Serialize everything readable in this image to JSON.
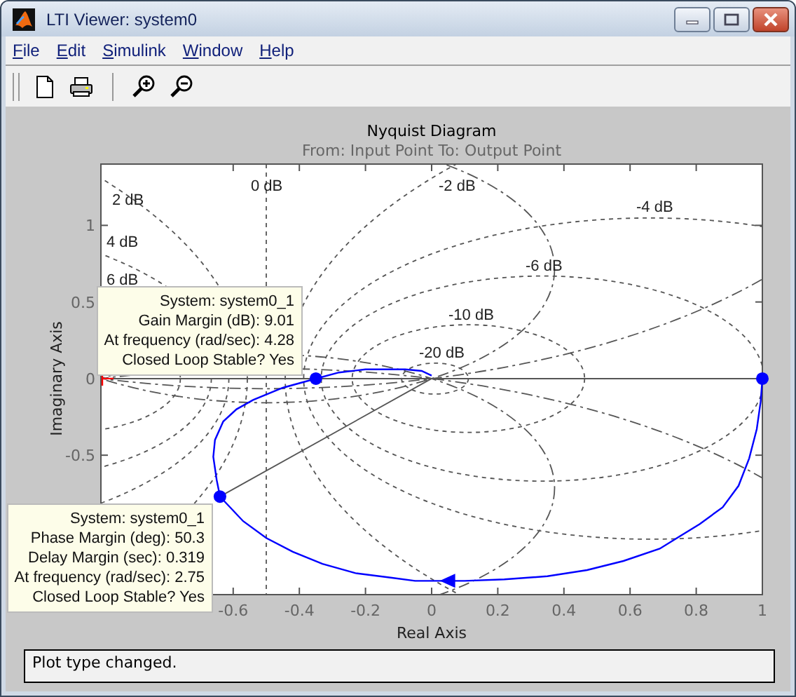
{
  "window": {
    "title": "LTI Viewer: system0"
  },
  "menu": [
    {
      "label": "File"
    },
    {
      "label": "Edit"
    },
    {
      "label": "Simulink"
    },
    {
      "label": "Window"
    },
    {
      "label": "Help"
    }
  ],
  "plot": {
    "chart_data": {
      "type": "line",
      "title": "Nyquist Diagram",
      "subtitle": "From: Input Point  To: Output Point",
      "xlabel": "Real Axis",
      "ylabel": "Imaginary Axis",
      "xlim": [
        -1,
        1
      ],
      "ylim": [
        -1.41,
        1.4
      ],
      "xticks": [
        -0.6,
        -0.4,
        -0.2,
        0,
        0.2,
        0.4,
        0.6,
        0.8,
        1
      ],
      "yticks": [
        -0.5,
        0,
        0.5,
        1
      ],
      "x": [
        1,
        0.995,
        0.983,
        0.96,
        0.928,
        0.88,
        0.81,
        0.69,
        0.58,
        0.47,
        0.35,
        0.22,
        0.1,
        0.05,
        -0.05,
        -0.12,
        -0.23,
        -0.33,
        -0.42,
        -0.5,
        -0.57,
        -0.64,
        -0.65,
        -0.66,
        -0.655,
        -0.63,
        -0.59,
        -0.54,
        -0.45,
        -0.35,
        -0.28,
        -0.2,
        -0.14,
        -0.08,
        -0.03,
        0
      ],
      "series": [
        {
          "color": "#0000ff",
          "values": [
            0,
            -0.15,
            -0.33,
            -0.52,
            -0.7,
            -0.84,
            -0.95,
            -1.11,
            -1.19,
            -1.25,
            -1.29,
            -1.31,
            -1.32,
            -1.32,
            -1.32,
            -1.3,
            -1.27,
            -1.21,
            -1.13,
            -1.04,
            -0.93,
            -0.77,
            -0.66,
            -0.51,
            -0.4,
            -0.28,
            -0.2,
            -0.14,
            -0.06,
            0,
            0.04,
            0.06,
            0.06,
            0.06,
            0.05,
            0.02
          ]
        }
      ],
      "ref_lines": [
        {
          "axis": "x",
          "value": -0.5,
          "label": "0 dB"
        }
      ],
      "annotations": [
        "2 dB",
        "4 dB",
        "6 dB",
        "-2 dB",
        "-4 dB",
        "-6 dB",
        "-10 dB",
        "-20 dB"
      ]
    },
    "data_tips": [
      {
        "lines": [
          "System: system0_1",
          "Gain Margin (dB): 9.01",
          "At frequency (rad/sec): 4.28",
          "Closed Loop Stable? Yes"
        ]
      },
      {
        "lines": [
          "System: system0_1",
          "Phase Margin (deg): 50.3",
          "Delay Margin (sec): 0.319",
          "At frequency (rad/sec): 2.75",
          "Closed Loop Stable? Yes"
        ]
      }
    ]
  },
  "status_bar": {
    "text": "Plot type changed."
  }
}
